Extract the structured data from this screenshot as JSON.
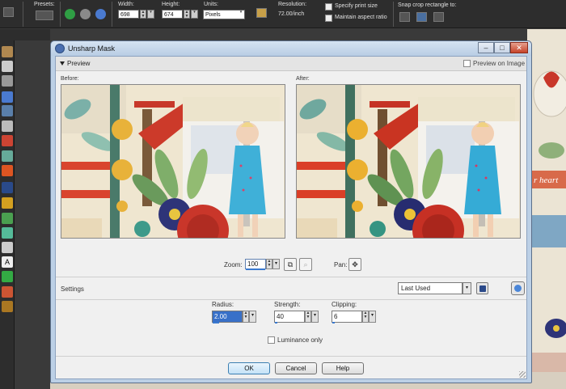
{
  "toolbar": {
    "presets_label": "Presets:",
    "width_label": "Width:",
    "width_value": "698",
    "height_label": "Height:",
    "height_value": "674",
    "units_label": "Units:",
    "units_value": "Pixels",
    "resolution_label": "Resolution:",
    "resolution_value": "72.00/inch",
    "specify_print_size": "Specify print size",
    "maintain_aspect": "Maintain aspect ratio",
    "snap_label": "Snap crop rectangle to:"
  },
  "dialog": {
    "title": "Unsharp Mask",
    "preview_label": "Preview",
    "preview_on_image": "Preview on Image",
    "before_label": "Before:",
    "after_label": "After:",
    "zoom_label": "Zoom:",
    "zoom_value": "100",
    "pan_label": "Pan:",
    "settings_label": "Settings",
    "preset_value": "Last Used",
    "radius_label": "Radius:",
    "radius_value": "2.00",
    "strength_label": "Strength:",
    "strength_value": "40",
    "clipping_label": "Clipping:",
    "clipping_value": "6",
    "luminance_label": "Luminance only",
    "ok_label": "OK",
    "cancel_label": "Cancel",
    "help_label": "Help"
  },
  "background": {
    "scrap_text": "r heart"
  },
  "colors": {
    "title_bar": "#bcd0e6",
    "dialog_body": "#f0f0f0",
    "accent_blue": "#3a7ad0",
    "dress_blue": "#3fb0d8"
  }
}
